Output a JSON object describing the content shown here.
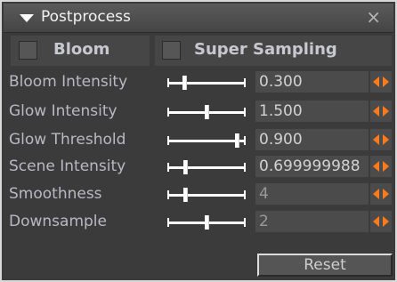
{
  "title": "Postprocess",
  "close_glyph": "×",
  "toggles": [
    {
      "label": "Bloom",
      "checked": false
    },
    {
      "label": "Super Sampling",
      "checked": false
    }
  ],
  "params": [
    {
      "label": "Bloom Intensity",
      "value": "0.300",
      "slider_fraction": 0.2
    },
    {
      "label": "Glow Intensity",
      "value": "1.500",
      "slider_fraction": 0.5
    },
    {
      "label": "Glow Threshold",
      "value": "0.900",
      "slider_fraction": 0.9
    },
    {
      "label": "Scene Intensity",
      "value": "0.699999988",
      "slider_fraction": 0.22
    },
    {
      "label": "Smoothness",
      "value": "4",
      "slider_fraction": 0.22
    },
    {
      "label": "Downsample",
      "value": "2",
      "slider_fraction": 0.5
    }
  ],
  "reset_label": "Reset",
  "colors": {
    "accent": "#ff7a1a",
    "panel": "#3b3b3b",
    "label": "#b9b9c4"
  }
}
